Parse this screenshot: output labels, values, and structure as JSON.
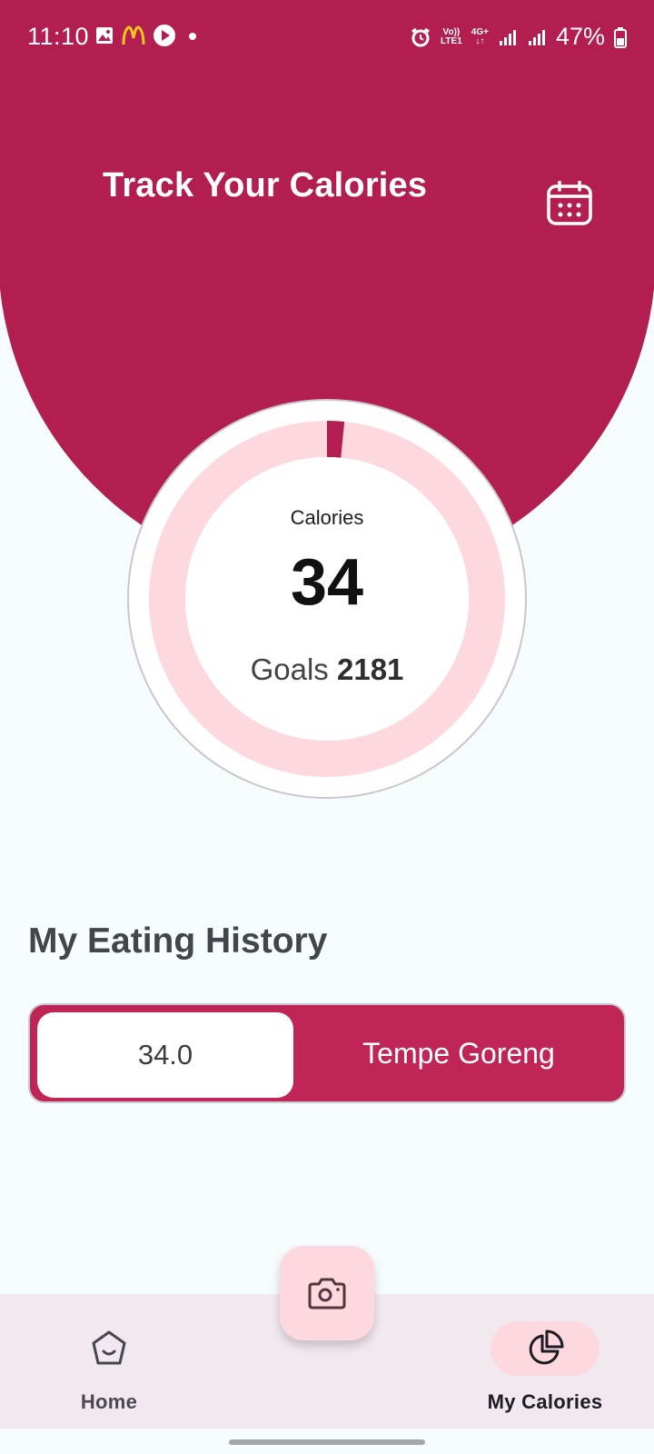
{
  "status_bar": {
    "time": "11:10",
    "volte": "Vo))",
    "lte": "LTE1",
    "network": "4G+",
    "battery": "47%"
  },
  "header": {
    "title": "Track Your Calories",
    "calendar_icon": "calendar-icon"
  },
  "gauge": {
    "label": "Calories",
    "value": "34",
    "goal_label": "Goals",
    "goal_value": "2181",
    "progress_fraction": 0.0156,
    "track_color": "#fdd9df",
    "fill_color": "#b21e4f"
  },
  "history": {
    "title": "My Eating History",
    "items": [
      {
        "amount": "34.0",
        "name": "Tempe Goreng"
      }
    ]
  },
  "fab": {
    "icon": "camera-icon"
  },
  "nav": {
    "home": {
      "label": "Home",
      "icon": "home-icon"
    },
    "calories": {
      "label": "My Calories",
      "icon": "pie-chart-icon"
    }
  },
  "colors": {
    "brand": "#b21e4f",
    "history_bg": "#bf2555",
    "accent_light": "#fdd9df",
    "background": "#f6fbfd"
  }
}
